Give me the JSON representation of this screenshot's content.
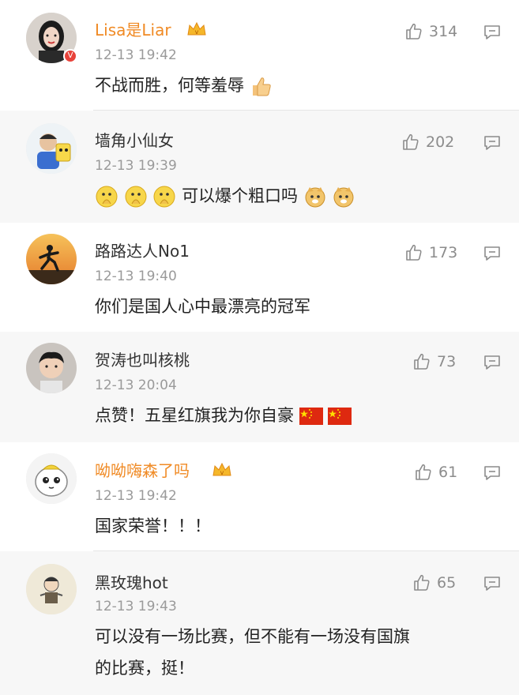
{
  "comments": [
    {
      "user": "Lisa是Liar",
      "time": "12-13 19:42",
      "likes": "314",
      "text": "不战而胜，何等羞辱",
      "vip": true,
      "verified": true,
      "emoji": "thumbs-up"
    },
    {
      "user": "墙角小仙女",
      "time": "12-13 19:39",
      "likes": "202",
      "text": "可以爆个粗口吗",
      "vip": false,
      "verified": false,
      "emoji": "pray-doge"
    },
    {
      "user": "路路达人No1",
      "time": "12-13 19:40",
      "likes": "173",
      "text": "你们是国人心中最漂亮的冠军",
      "vip": false,
      "verified": false,
      "emoji": ""
    },
    {
      "user": "贺涛也叫核桃",
      "time": "12-13 20:04",
      "likes": "73",
      "text": "点赞！五星红旗我为你自豪",
      "vip": false,
      "verified": false,
      "emoji": "china-flag"
    },
    {
      "user": "呦呦嗨森了吗",
      "time": "12-13 19:42",
      "likes": "61",
      "text": "国家荣誉！！！",
      "vip": true,
      "verified": false,
      "emoji": ""
    },
    {
      "user": "黑玫瑰hot",
      "time": "12-13 19:43",
      "likes": "65",
      "text_line1": "可以没有一场比赛，但不能有一场没有国旗",
      "text_line2": "的比赛，挺！",
      "vip": false,
      "verified": false,
      "emoji": ""
    }
  ],
  "colors": {
    "vip_name": "#f08a24",
    "normal_name": "#333333",
    "time": "#9a9a9a",
    "like": "#8c8c8c",
    "badge": "#e8433b"
  }
}
